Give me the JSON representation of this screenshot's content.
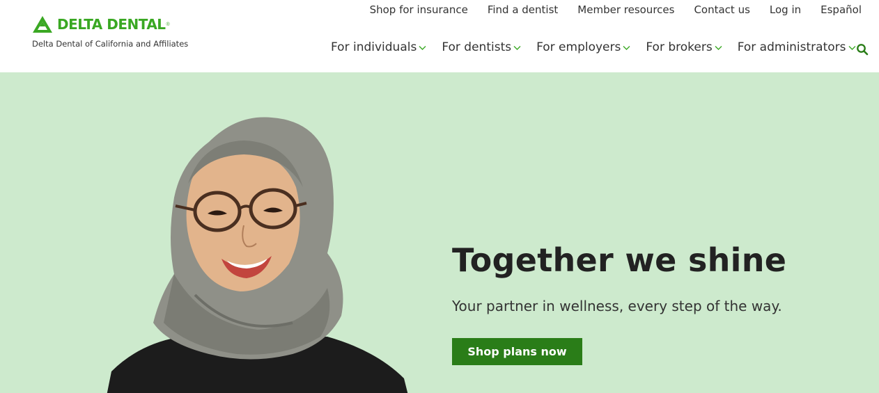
{
  "brand": {
    "name": "DELTA DENTAL",
    "reg_mark": "®",
    "tagline": "Delta Dental of California and Affiliates",
    "color": "#3aa823"
  },
  "utility_nav": [
    {
      "label": "Shop for insurance"
    },
    {
      "label": "Find a dentist"
    },
    {
      "label": "Member resources"
    },
    {
      "label": "Contact us"
    },
    {
      "label": "Log in"
    },
    {
      "label": "Español"
    }
  ],
  "main_nav": [
    {
      "label": "For individuals",
      "icon": "chevron-down-icon"
    },
    {
      "label": "For dentists",
      "icon": "chevron-down-icon"
    },
    {
      "label": "For employers",
      "icon": "chevron-down-icon"
    },
    {
      "label": "For brokers",
      "icon": "chevron-down-icon"
    },
    {
      "label": "For administrators",
      "icon": "chevron-down-icon"
    }
  ],
  "search": {
    "icon": "search-icon"
  },
  "hero": {
    "title": "Together we shine",
    "subtitle": "Your partner in wellness, every step of the way.",
    "cta_label": "Shop plans now",
    "background": "#cdeacd",
    "cta_color": "#2a7d18"
  }
}
